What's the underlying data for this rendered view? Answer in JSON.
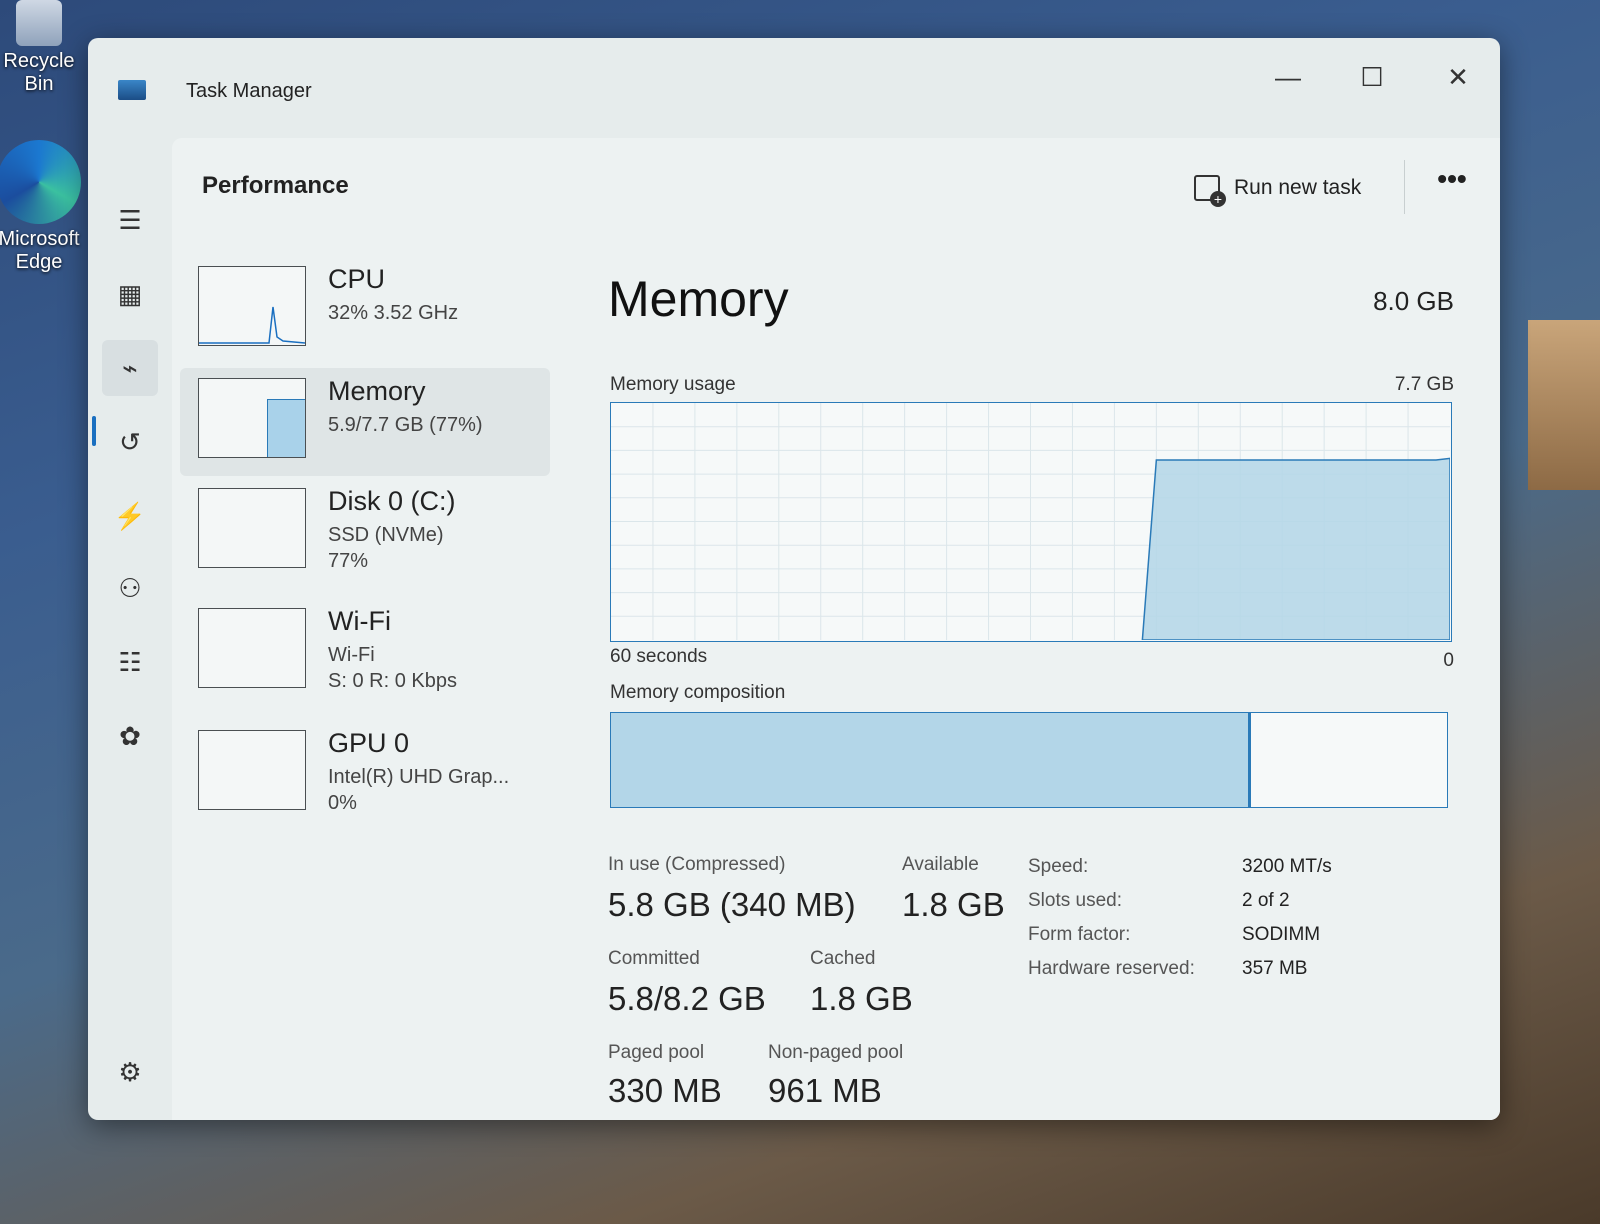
{
  "desktop": {
    "recycle_bin": "Recycle Bin",
    "edge_line1": "Microsoft",
    "edge_line2": "Edge"
  },
  "window": {
    "title": "Task Manager",
    "minimize_icon": "minimize-icon",
    "maximize_icon": "maximize-icon",
    "close_icon": "close-icon"
  },
  "nav": {
    "items": [
      {
        "name": "hamburger-icon",
        "glyph": "☰"
      },
      {
        "name": "processes-icon",
        "glyph": "▦"
      },
      {
        "name": "performance-icon",
        "glyph": "⌁",
        "active": true
      },
      {
        "name": "app-history-icon",
        "glyph": "↺"
      },
      {
        "name": "startup-apps-icon",
        "glyph": "⚡"
      },
      {
        "name": "users-icon",
        "glyph": "⚇"
      },
      {
        "name": "details-icon",
        "glyph": "☷"
      },
      {
        "name": "services-icon",
        "glyph": "✿"
      }
    ],
    "settings_glyph": "⚙"
  },
  "header": {
    "title": "Performance",
    "run_new_task": "Run new task",
    "more": "•••"
  },
  "devices": [
    {
      "name": "CPU",
      "sub": "32% 3.52 GHz",
      "sub2": ""
    },
    {
      "name": "Memory",
      "sub": "5.9/7.7 GB (77%)",
      "sub2": ""
    },
    {
      "name": "Disk 0 (C:)",
      "sub": "SSD (NVMe)",
      "sub2": "77%"
    },
    {
      "name": "Wi-Fi",
      "sub": "Wi-Fi",
      "sub2": "S: 0 R: 0 Kbps"
    },
    {
      "name": "GPU 0",
      "sub": "Intel(R) UHD Grap...",
      "sub2": "0%"
    }
  ],
  "memory": {
    "title": "Memory",
    "total": "8.0 GB",
    "usage_label": "Memory usage",
    "usage_max": "7.7 GB",
    "axis_left": "60 seconds",
    "axis_right": "0",
    "composition_label": "Memory composition",
    "composition_in_use_fraction": 0.765,
    "usage_history_gb": [
      0,
      0,
      0,
      0,
      0,
      0,
      0,
      0,
      0,
      0,
      0,
      0,
      0,
      0,
      0,
      0,
      0,
      0,
      0,
      0,
      0,
      0,
      0,
      0,
      0,
      0,
      0,
      0,
      0,
      0,
      0,
      0,
      0,
      0,
      0,
      0,
      0,
      0,
      0,
      5.85,
      5.85,
      5.85,
      5.85,
      5.85,
      5.85,
      5.85,
      5.85,
      5.85,
      5.85,
      5.85,
      5.85,
      5.85,
      5.85,
      5.85,
      5.85,
      5.85,
      5.85,
      5.85,
      5.85,
      5.85,
      5.9
    ],
    "stats": {
      "in_use_label": "In use (Compressed)",
      "in_use_value": "5.8 GB (340 MB)",
      "available_label": "Available",
      "available_value": "1.8 GB",
      "committed_label": "Committed",
      "committed_value": "5.8/8.2 GB",
      "cached_label": "Cached",
      "cached_value": "1.8 GB",
      "paged_label": "Paged pool",
      "paged_value": "330 MB",
      "nonpaged_label": "Non-paged pool",
      "nonpaged_value": "961 MB"
    },
    "specs": [
      {
        "label": "Speed:",
        "value": "3200 MT/s"
      },
      {
        "label": "Slots used:",
        "value": "2 of 2"
      },
      {
        "label": "Form factor:",
        "value": "SODIMM"
      },
      {
        "label": "Hardware reserved:",
        "value": "357 MB"
      }
    ]
  },
  "colors": {
    "accent": "#2a7ab8",
    "graph_fill": "#b3d6e8"
  }
}
